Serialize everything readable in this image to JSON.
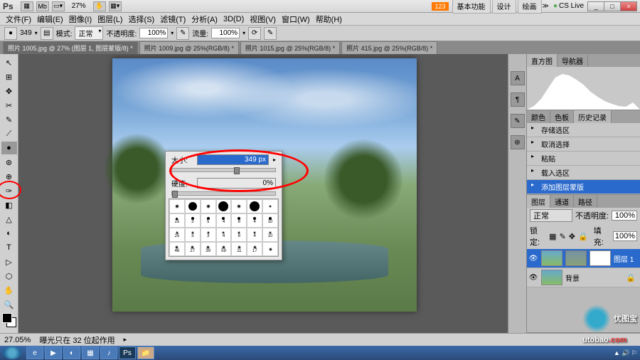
{
  "titlebar": {
    "app": "Ps",
    "zoom": "27%",
    "badge": "123",
    "tabs": [
      "基本功能",
      "设计",
      "绘画"
    ],
    "cslive": "CS Live",
    "win": [
      "_",
      "□",
      "×"
    ]
  },
  "menu": [
    "文件(F)",
    "编辑(E)",
    "图像(I)",
    "图层(L)",
    "选择(S)",
    "滤镜(T)",
    "分析(A)",
    "3D(D)",
    "视图(V)",
    "窗口(W)",
    "帮助(H)"
  ],
  "optbar": {
    "size": "349",
    "mode_label": "模式:",
    "mode": "正常",
    "opacity_label": "不透明度:",
    "opacity": "100%",
    "flow_label": "流量:",
    "flow": "100%"
  },
  "doctabs": [
    {
      "label": "照片 1005.jpg @ 27% (图层 1, 图层蒙版/8) *",
      "active": true
    },
    {
      "label": "照片 1009.jpg @ 25%(RGB/8) *",
      "active": false
    },
    {
      "label": "照片 1015.jpg @ 25%(RGB/8) *",
      "active": false
    },
    {
      "label": "照片 415.jpg @ 25%(RGB/8) *",
      "active": false
    }
  ],
  "tools": [
    "↖",
    "⊞",
    "✥",
    "✂",
    "✎",
    "⟋",
    "●",
    "⊛",
    "⊕",
    "✑",
    "◧",
    "△",
    "◐",
    "T",
    "▷",
    "⬡",
    "✋",
    "🔍"
  ],
  "popup": {
    "size_label": "大小:",
    "size_value": "349 px",
    "hardness_label": "硬度:",
    "hardness_value": "0%",
    "size_pos": 60,
    "hardness_pos": 0,
    "brushes": [
      {
        "s": 6,
        "t": "soft"
      },
      {
        "s": 12,
        "t": "hard"
      },
      {
        "s": 6,
        "t": "soft"
      },
      {
        "s": 14,
        "t": "hard"
      },
      {
        "s": 6,
        "t": "soft"
      },
      {
        "s": 14,
        "t": "hard"
      },
      {
        "s": 4,
        "t": "soft"
      },
      {
        "s": 3,
        "t": "hard",
        "n": "25"
      },
      {
        "s": 4,
        "t": "hard",
        "n": "3"
      },
      {
        "s": 4,
        "t": "hard",
        "n": "5"
      },
      {
        "s": 4,
        "t": "hard",
        "n": "4"
      },
      {
        "s": 4,
        "t": "hard",
        "n": "8"
      },
      {
        "s": 4,
        "t": "hard",
        "n": "4"
      },
      {
        "s": 4,
        "t": "hard",
        "n": "10"
      },
      {
        "s": 4,
        "t": "soft",
        "n": "25"
      },
      {
        "s": 4,
        "t": "soft",
        "n": "3"
      },
      {
        "s": 4,
        "t": "soft",
        "n": "3"
      },
      {
        "s": 4,
        "t": "soft",
        "n": "4"
      },
      {
        "s": 4,
        "t": "soft",
        "n": "8"
      },
      {
        "s": 4,
        "t": "soft",
        "n": "4"
      },
      {
        "s": 4,
        "t": "soft",
        "n": "10"
      },
      {
        "s": 5,
        "t": "soft",
        "n": "46"
      },
      {
        "s": 5,
        "t": "soft",
        "n": "27"
      },
      {
        "s": 5,
        "t": "soft",
        "n": "39"
      },
      {
        "s": 5,
        "t": "soft",
        "n": "59"
      },
      {
        "s": 5,
        "t": "soft",
        "n": "11"
      },
      {
        "s": 5,
        "t": "soft",
        "n": "17"
      },
      {
        "s": 5,
        "t": "soft"
      }
    ]
  },
  "panels": {
    "histogram_tabs": [
      "直方图",
      "导航器"
    ],
    "history_tab": "历史记录",
    "history_tabs_left": [
      "颜色",
      "色板"
    ],
    "history": [
      {
        "label": "存储选区"
      },
      {
        "label": "取消选择"
      },
      {
        "label": "粘贴"
      },
      {
        "label": "载入选区"
      },
      {
        "label": "添加图层蒙版",
        "sel": true
      }
    ],
    "layers_tabs": [
      "图层",
      "通道",
      "路径"
    ],
    "blend": "正常",
    "opacity_label": "不透明度:",
    "opacity": "100%",
    "lock_label": "锁定:",
    "fill_label": "填充:",
    "fill": "100%",
    "layers": [
      {
        "name": "图层 1",
        "sel": true,
        "mask": true,
        "dup": true
      },
      {
        "name": "背景",
        "sel": false,
        "lock": true
      }
    ]
  },
  "status": {
    "zoom": "27.05%",
    "info": "曝光只在 32 位起作用"
  },
  "watermark": {
    "text": "优图宝",
    "url": "utobao",
    "dotcom": ".com"
  }
}
